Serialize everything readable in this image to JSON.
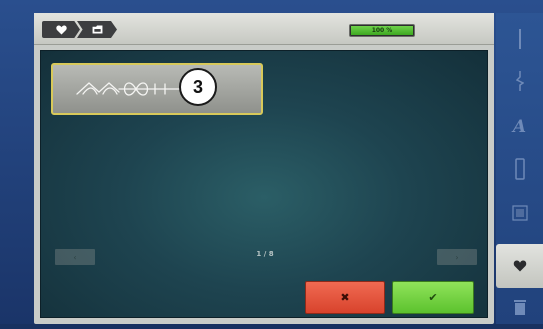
{
  "breadcrumb": {
    "items": [
      {
        "icon": "heart-icon"
      },
      {
        "icon": "folder-icon"
      }
    ]
  },
  "progress": {
    "label": "100 %",
    "percent": 100
  },
  "stitch_tile": {
    "icon": "decorative-stitch-pattern-icon",
    "callout": "3"
  },
  "pagination": {
    "indicator": "1 / 8",
    "prev_label": "‹",
    "next_label": "›"
  },
  "actions": {
    "cancel_label": "✖",
    "confirm_label": "✔"
  },
  "sidebar": {
    "items": [
      {
        "icon": "line-stitch-icon"
      },
      {
        "icon": "zigzag-stitch-icon"
      },
      {
        "icon": "alphabet-icon",
        "label": "A"
      },
      {
        "icon": "buttonhole-icon"
      },
      {
        "icon": "quilt-stitch-icon"
      },
      {
        "icon": "heart-icon",
        "active": true
      },
      {
        "icon": "trash-icon"
      }
    ]
  },
  "colors": {
    "accent_green": "#5cc22e",
    "cancel_red": "#d8432c",
    "tile_highlight": "#d8c95a"
  }
}
